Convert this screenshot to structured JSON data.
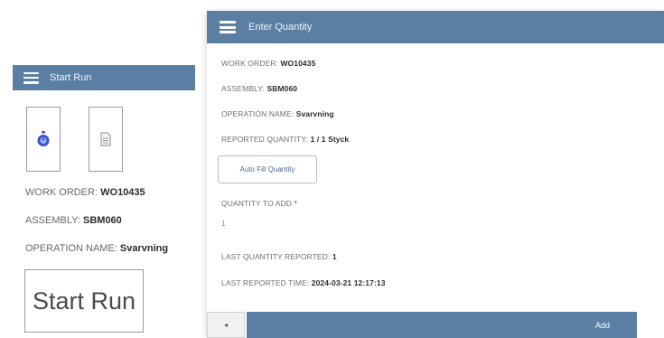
{
  "left_panel": {
    "title": "Start Run",
    "work_order_label": "WORK ORDER: ",
    "work_order_value": "WO10435",
    "assembly_label": "ASSEMBLY: ",
    "assembly_value": "SBM060",
    "operation_label": "OPERATION NAME: ",
    "operation_value": "Svarvning",
    "start_run_label": "Start Run",
    "icons": [
      "stopwatch-icon",
      "document-icon"
    ]
  },
  "right_panel": {
    "title": "Enter Quantity",
    "work_order_label": "WORK ORDER: ",
    "work_order_value": "WO10435",
    "assembly_label": "ASSEMBLY: ",
    "assembly_value": "SBM060",
    "operation_label": "OPERATION NAME: ",
    "operation_value": "Svarvning",
    "reported_qty_label": "REPORTED QUANTITY: ",
    "reported_qty_value": "1 / 1 Styck",
    "autofill_label": "Auto Fill Quantity",
    "qty_to_add_label": "QUANTITY TO ADD ",
    "qty_required_mark": "*",
    "qty_to_add_value": "1",
    "last_qty_label": "LAST QUANTITY REPORTED: ",
    "last_qty_value": "1",
    "last_time_label": "LAST REPORTED TIME: ",
    "last_time_value": "2024-03-21 12:17:13",
    "back_glyph": "◂",
    "add_label": "Add"
  },
  "colors": {
    "header": "#5b7fa3",
    "accent_icon": "#3f4fc2"
  }
}
